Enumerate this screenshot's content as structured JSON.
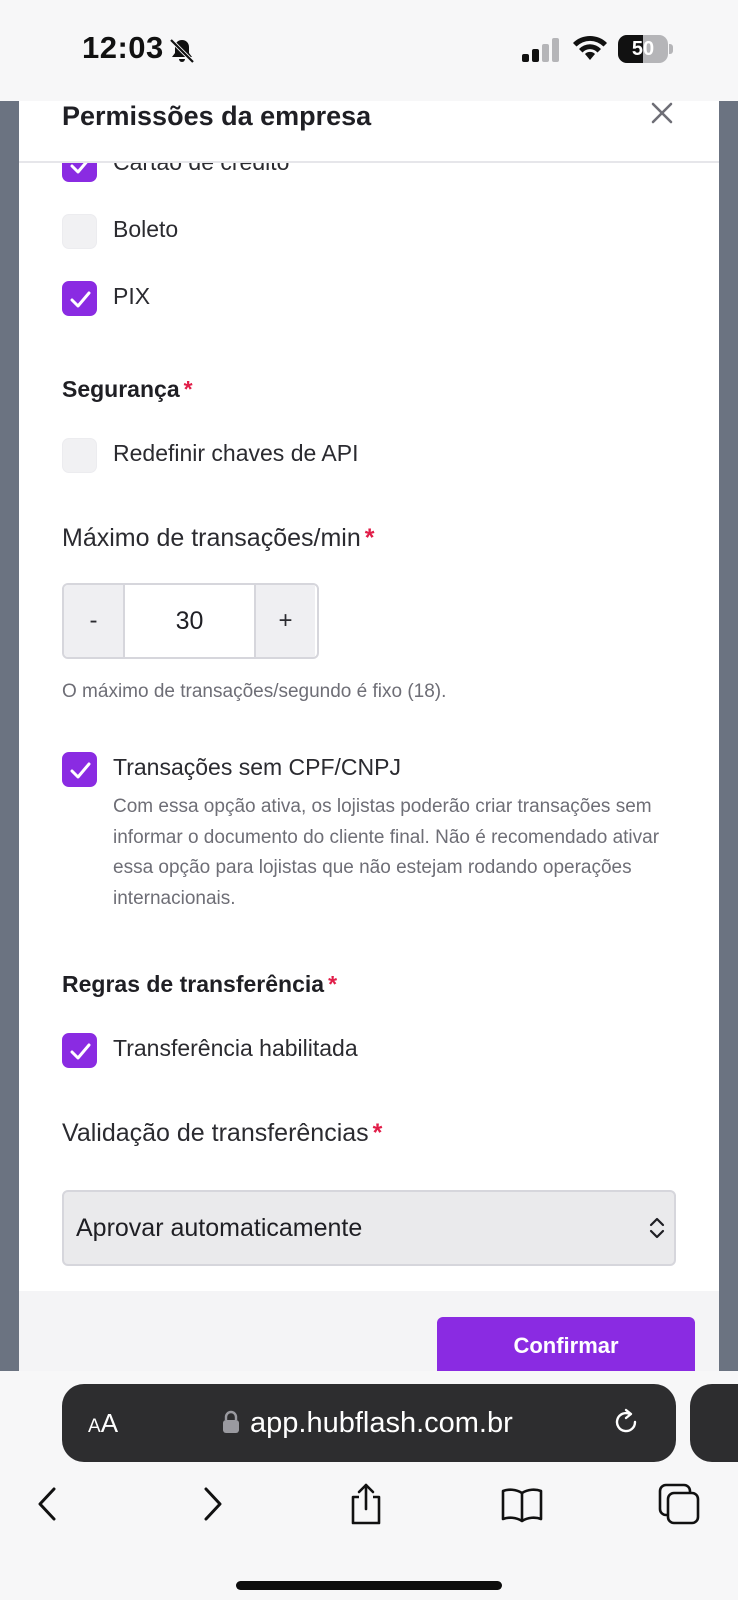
{
  "status_bar": {
    "time": "12:03",
    "battery_level": "50",
    "battery_fraction": 0.5,
    "icons": [
      "bell-slash-icon",
      "cellular-signal-icon",
      "wifi-icon",
      "battery-icon"
    ]
  },
  "modal": {
    "title": "Permissões da empresa",
    "payment_methods": [
      {
        "label": "Cartão de crédito",
        "checked": true
      },
      {
        "label": "Boleto",
        "checked": false
      },
      {
        "label": "PIX",
        "checked": true
      }
    ],
    "security": {
      "title": "Segurança",
      "required_mark": "*",
      "reset_api_keys": {
        "label": "Redefinir chaves de API",
        "checked": false
      }
    },
    "max_transactions": {
      "label": "Máximo de transações/min",
      "required_mark": "*",
      "decrement_label": "-",
      "value": "30",
      "increment_label": "+",
      "helper": "O máximo de transações/segundo é fixo (18)."
    },
    "no_document": {
      "label": "Transações sem CPF/CNPJ",
      "checked": true,
      "description": "Com essa opção ativa, os lojistas poderão criar transações sem informar o documento do cliente final. Não é recomendado ativar essa opção para lojistas que não estejam rodando operações internacionais."
    },
    "transfer_rules": {
      "title": "Regras de transferência",
      "required_mark": "*",
      "enabled": {
        "label": "Transferência habilitada",
        "checked": true
      }
    },
    "transfer_validation": {
      "label": "Validação de transferências",
      "required_mark": "*",
      "selected": "Aprovar automaticamente"
    },
    "confirm_label": "Confirmar"
  },
  "browser": {
    "aa_small": "A",
    "aa_large": "A",
    "url": "app.hubflash.com.br",
    "toolbar_icons": [
      "back-icon",
      "forward-icon",
      "share-icon",
      "bookmarks-icon",
      "tabs-icon"
    ]
  },
  "colors": {
    "accent": "#8a2be2",
    "required": "#e11d48",
    "backdrop": "#6b7381"
  }
}
